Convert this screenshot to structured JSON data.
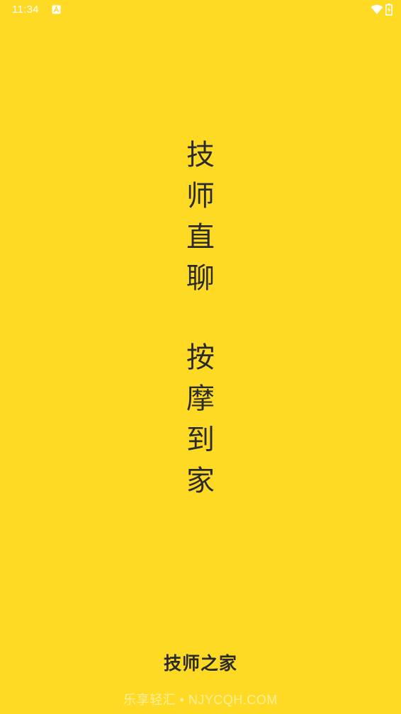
{
  "status_bar": {
    "time": "11:34",
    "notification_icon": "a-notification-icon",
    "wifi_icon": "wifi-icon",
    "battery_icon": "battery-charging-icon"
  },
  "slogan": {
    "line1": [
      "技",
      "师",
      "直",
      "聊"
    ],
    "line2": [
      "按",
      "摩",
      "到",
      "家"
    ]
  },
  "app_name": "技师之家",
  "watermark": "乐享轻汇 • NJYCQH.COM",
  "colors": {
    "background": "#FFDA24",
    "text": "#2b2b2b",
    "status_text": "#ffffff"
  }
}
